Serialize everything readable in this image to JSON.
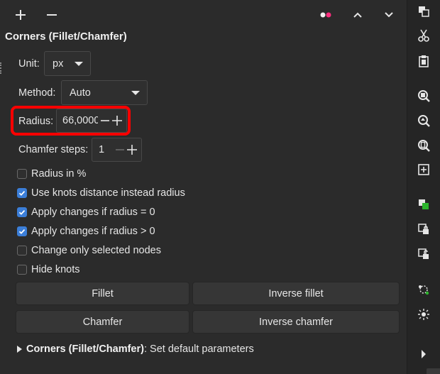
{
  "panel": {
    "title": "Corners (Fillet/Chamfer)",
    "unit": {
      "label": "Unit:",
      "value": "px"
    },
    "method": {
      "label": "Method:",
      "value": "Auto"
    },
    "radius": {
      "label": "Radius:",
      "value": "66,0000"
    },
    "chamfer_steps": {
      "label": "Chamfer steps:",
      "value": "1"
    },
    "checkboxes": [
      {
        "label": "Radius in %",
        "checked": false
      },
      {
        "label": "Use knots distance instead radius",
        "checked": true
      },
      {
        "label": "Apply changes if radius = 0",
        "checked": true
      },
      {
        "label": "Apply changes if radius > 0",
        "checked": true
      },
      {
        "label": "Change only selected nodes",
        "checked": false
      },
      {
        "label": "Hide knots",
        "checked": false
      }
    ],
    "buttons": {
      "fillet": "Fillet",
      "inverse_fillet": "Inverse fillet",
      "chamfer": "Chamfer",
      "inverse_chamfer": "Inverse chamfer"
    },
    "footer": {
      "title": "Corners (Fillet/Chamfer)",
      "text": ": Set default parameters"
    }
  },
  "colors": {
    "accent_check": "#3b7ed8",
    "highlight": "#ff0000",
    "dot_pink": "#ff2e7e",
    "dot_white": "#f0f0f0",
    "green": "#2db52d"
  },
  "icons": {
    "toolbar": [
      "plus-icon",
      "minus-icon",
      "dots-icon",
      "chevron-up-icon",
      "chevron-down-icon"
    ],
    "sidebar": [
      "duplicate-icon",
      "cut-icon",
      "paste-icon",
      "zoom-selection-icon",
      "zoom-drawing-icon",
      "zoom-page-icon",
      "zoom-fit-icon",
      "fill-icon",
      "lock-icon",
      "unlock-icon",
      "snap-icon",
      "center-icon",
      "more-icon"
    ]
  }
}
